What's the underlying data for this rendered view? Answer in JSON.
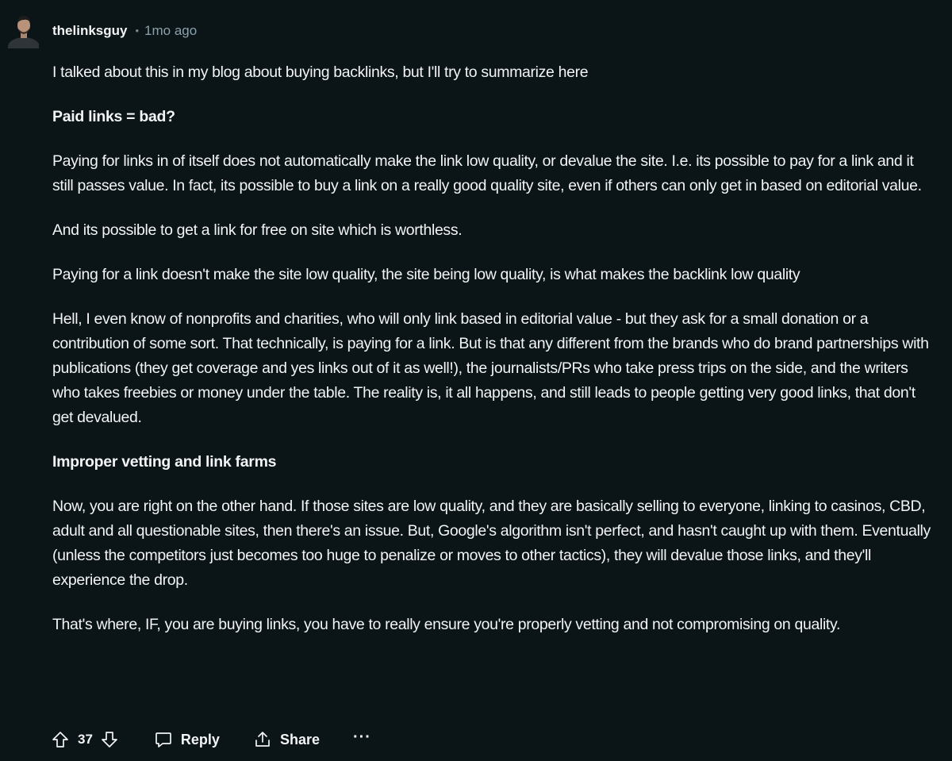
{
  "comment": {
    "author": "thelinksguy",
    "separator": "•",
    "timestamp": "1mo ago",
    "paragraphs": [
      "I talked about this in my blog about buying backlinks, but I'll try to summarize here",
      "Paid links = bad?",
      "Paying for links in of itself does not automatically make the link low quality, or devalue the site. I.e. its possible to pay for a link and it still passes value. In fact, its possible to buy a link on a really good quality site, even if others can only get in based on editorial value.",
      "And its possible to get a link for free on site which is worthless.",
      "Paying for a link doesn't make the site low quality, the site being low quality, is what makes the backlink low quality",
      "Hell, I even know of nonprofits and charities, who will only link based in editorial value - but they ask for a small donation or a contribution of some sort. That technically, is paying for a link. But is that any different from the brands who do brand partnerships with publications (they get coverage and yes links out of it as well!), the journalists/PRs who take press trips on the side, and the writers who takes freebies or money under the table. The reality is, it all happens, and still leads to people getting very good links, that don't get devalued.",
      "Improper vetting and link farms",
      "Now, you are right on the other hand. If those sites are low quality, and they are basically selling to everyone, linking to casinos, CBD, adult and all questionable sites, then there's an issue. But, Google's algorithm isn't perfect, and hasn't caught up with them. Eventually (unless the competitors just becomes too huge to penalize or moves to other tactics), they will devalue those links, and they'll experience the drop.",
      "That's where, IF, you are buying links, you have to really ensure you're properly vetting and not compromising on quality."
    ]
  },
  "actions": {
    "upvote_icon": "upvote-arrow-icon",
    "score": "37",
    "downvote_icon": "downvote-arrow-icon",
    "reply_icon": "speech-bubble-icon",
    "reply_label": "Reply",
    "share_icon": "share-upload-icon",
    "share_label": "Share",
    "more_label": "···"
  },
  "colors": {
    "background": "#0b1416",
    "text": "#f2f4f5",
    "meta": "#8ba2ad"
  }
}
